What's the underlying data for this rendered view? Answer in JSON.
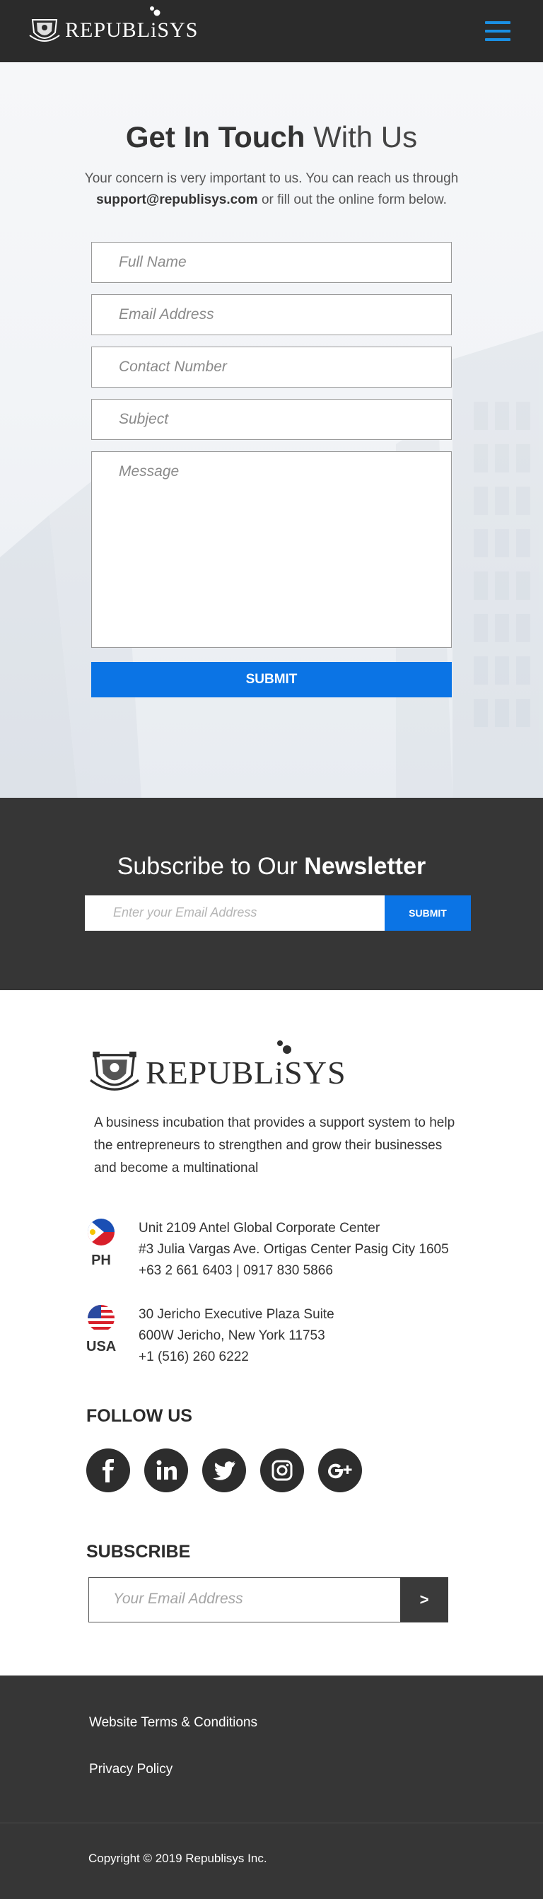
{
  "header": {
    "brand": "REPUBLiSYS",
    "menu_icon": "hamburger-icon",
    "menu_color": "#1a8fe3"
  },
  "contact": {
    "title_bold": "Get In Touch",
    "title_light": "With Us",
    "lead_line1": "Your concern is very important to us. You can reach us through",
    "lead_email": "support@republisys.com",
    "lead_rest": "or fill out the online form below.",
    "fields": {
      "full_name": "Full Name",
      "email": "Email Address",
      "contact": "Contact Number",
      "subject": "Subject",
      "message": "Message"
    },
    "submit": "SUBMIT"
  },
  "newsletter": {
    "title_light": "Subscribe to Our",
    "title_bold": "Newsletter",
    "placeholder": "Enter your Email Address",
    "submit": "SUBMIT"
  },
  "footer": {
    "brand": "REPUBLiSYS",
    "tagline": "A business incubation that provides a support system to help the entrepreneurs to strengthen and grow their businesses and become a multinational",
    "offices": [
      {
        "code": "PH",
        "line1": "Unit 2109 Antel Global Corporate Center",
        "line2": "#3 Julia Vargas Ave. Ortigas Center Pasig City 1605",
        "line3": "+63 2 661 6403 | 0917 830 5866"
      },
      {
        "code": "USA",
        "line1": "30 Jericho Executive Plaza Suite",
        "line2": "600W Jericho, New York 11753",
        "line3": "+1 (516) 260 6222"
      }
    ],
    "follow_title": "FOLLOW US",
    "socials": [
      "facebook-icon",
      "linkedin-icon",
      "twitter-icon",
      "instagram-icon",
      "google-plus-icon"
    ],
    "subscribe_title": "SUBSCRIBE",
    "subscribe_placeholder": "Your Email Address",
    "subscribe_btn": ">"
  },
  "bottom": {
    "links": [
      "Website Terms & Conditions",
      "Privacy Policy"
    ],
    "copyright": "Copyright © 2019 Republisys Inc."
  },
  "colors": {
    "accent": "#0b74e5",
    "dark": "#363636",
    "header": "#2b2b2b"
  }
}
